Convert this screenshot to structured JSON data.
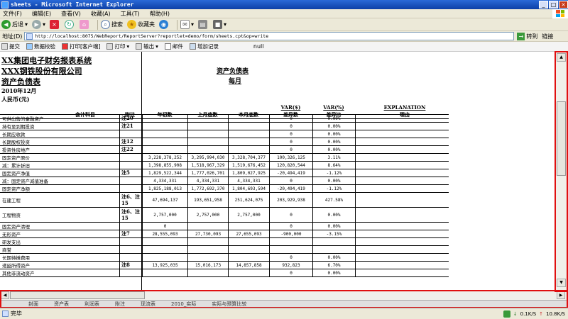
{
  "window": {
    "title": "sheets - Microsoft Internet Explorer"
  },
  "menu": [
    "文件(F)",
    "编辑(E)",
    "查看(V)",
    "收藏(A)",
    "工具(T)",
    "帮助(H)"
  ],
  "toolbar": {
    "back": "后退",
    "search": "搜索",
    "favorites": "收藏夹"
  },
  "address": {
    "label": "地址(D)",
    "url": "http://localhost:8075/WebReport/ReportServer?reportlet=demo/form/sheets.cpt&op=write",
    "go": "转到",
    "links": "链接"
  },
  "reportbar": {
    "submit": "提交",
    "verify": "数据校验",
    "print_client": "打印[客户端]",
    "print": "打印",
    "export": "输出",
    "mail": "邮件",
    "add_record": "增加记录",
    "null_text": "null"
  },
  "header": {
    "group": "XX集团电子财务报表系统",
    "company": "XXX钢铁股份有限公司",
    "sheet": "资产负债表",
    "date": "2010年12月",
    "unit": "人民币(元)",
    "report_title": "资产负债表",
    "report_sub": "每月"
  },
  "columns": {
    "item": "会计科目",
    "note": "附注",
    "begin": "年初数",
    "last_month": "上月底数",
    "this_month": "本月底数",
    "var_usd_top": "VAR($)",
    "var_usd": "差异数",
    "var_pct_top": "VAR(%)",
    "var_pct": "差异比",
    "explain_top": "EXPLANATION",
    "explain": "理由"
  },
  "rows": [
    {
      "name": "可供出售的金融资产",
      "note": "注20",
      "begin": "",
      "last": "",
      "cur": "",
      "diff": "0",
      "pct": "0.00%"
    },
    {
      "name": "持有至到期投资",
      "note": "注21",
      "begin": "",
      "last": "",
      "cur": "",
      "diff": "0",
      "pct": "0.00%"
    },
    {
      "name": "长期应收款",
      "note": "",
      "begin": "",
      "last": "",
      "cur": "",
      "diff": "0",
      "pct": "0.00%"
    },
    {
      "name": "长期股权投资",
      "note": "注12",
      "begin": "",
      "last": "",
      "cur": "",
      "diff": "0",
      "pct": "0.00%"
    },
    {
      "name": "投资性房地产",
      "note": "注22",
      "begin": "",
      "last": "",
      "cur": "",
      "diff": "0",
      "pct": "0.00%"
    },
    {
      "name": "固定资产原价",
      "note": "",
      "begin": "3,228,378,252",
      "last": "3,295,994,030",
      "cur": "3,328,704,377",
      "diff": "100,326,125",
      "pct": "3.11%"
    },
    {
      "name": "减：累计折旧",
      "note": "",
      "begin": "1,398,855,908",
      "last": "1,518,967,329",
      "cur": "1,519,676,452",
      "diff": "120,820,544",
      "pct": "8.64%"
    },
    {
      "name": "固定资产净值",
      "note": "注5",
      "begin": "1,829,522,344",
      "last": "1,777,026,701",
      "cur": "1,809,027,925",
      "diff": "-20,494,419",
      "pct": "-1.12%"
    },
    {
      "name": "减：固定资产减值准备",
      "note": "",
      "begin": "4,334,331",
      "last": "4,334,331",
      "cur": "4,334,331",
      "diff": "0",
      "pct": "0.00%"
    },
    {
      "name": "固定资产净额",
      "note": "",
      "begin": "1,825,188,013",
      "last": "1,772,692,370",
      "cur": "1,804,693,594",
      "diff": "-20,494,419",
      "pct": "-1.12%"
    },
    {
      "name": "在建工程",
      "note": "注6、注15",
      "begin": "47,694,137",
      "last": "193,651,958",
      "cur": "251,624,075",
      "diff": "203,929,938",
      "pct": "427.58%"
    },
    {
      "name": "工程物资",
      "note": "注6、注15",
      "begin": "2,757,000",
      "last": "2,757,000",
      "cur": "2,757,000",
      "diff": "0",
      "pct": "0.00%"
    },
    {
      "name": "固定资产清理",
      "note": "",
      "begin": "0",
      "last": "",
      "cur": "",
      "diff": "0",
      "pct": "0.00%"
    },
    {
      "name": "无形资产",
      "note": "注7",
      "begin": "28,555,093",
      "last": "27,730,093",
      "cur": "27,655,093",
      "diff": "-900,000",
      "pct": "-3.15%"
    },
    {
      "name": "研发支出",
      "note": "",
      "begin": "",
      "last": "",
      "cur": "",
      "diff": "",
      "pct": ""
    },
    {
      "name": "商誉",
      "note": "",
      "begin": "",
      "last": "",
      "cur": "",
      "diff": "",
      "pct": ""
    },
    {
      "name": "长期待摊费用",
      "note": "",
      "begin": "",
      "last": "",
      "cur": "",
      "diff": "0",
      "pct": "0.00%"
    },
    {
      "name": "递延所得资产",
      "note": "注8",
      "begin": "13,925,035",
      "last": "15,016,173",
      "cur": "14,857,858",
      "diff": "932,823",
      "pct": "6.70%"
    },
    {
      "name": "其他非流动资产",
      "note": "",
      "begin": "",
      "last": "",
      "cur": "",
      "diff": "0",
      "pct": "0.00%"
    }
  ],
  "sheet_tabs": [
    "封面",
    "资产表",
    "利润表",
    "附注",
    "现流表",
    "2010_实际",
    "实际与预算比较"
  ],
  "status": {
    "text": "完毕",
    "down": "0.1K/S",
    "up": "10.8K/S"
  },
  "colors": {
    "accent": "#e01010"
  }
}
